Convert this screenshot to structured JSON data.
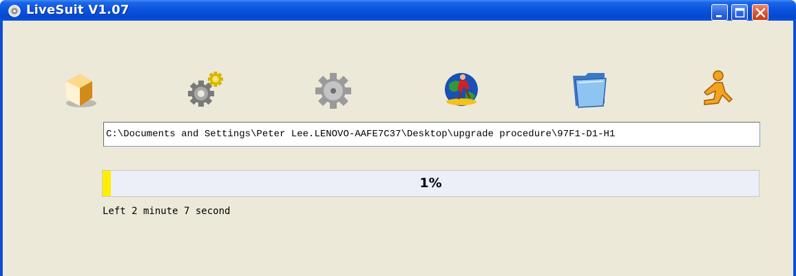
{
  "window": {
    "title": "LiveSuit V1.07",
    "controls": [
      "minimize",
      "maximize",
      "close"
    ]
  },
  "toolbar": {
    "icons": [
      "package-box-icon",
      "settings-gears-icon",
      "gear-icon",
      "globe-person-icon",
      "folder-icon",
      "running-man-icon"
    ]
  },
  "file": {
    "path": "C:\\Documents and Settings\\Peter Lee.LENOVO-AAFE7C37\\Desktop\\upgrade procedure\\97F1-D1-H1"
  },
  "progress": {
    "percent": 1,
    "label": "1%",
    "fill_color": "#ffee00"
  },
  "status": {
    "text": "Left 2 minute 7 second"
  },
  "colors": {
    "titlebar": "#0a55de",
    "client_bg": "#ece9d8",
    "close_button": "#d84f2a"
  }
}
